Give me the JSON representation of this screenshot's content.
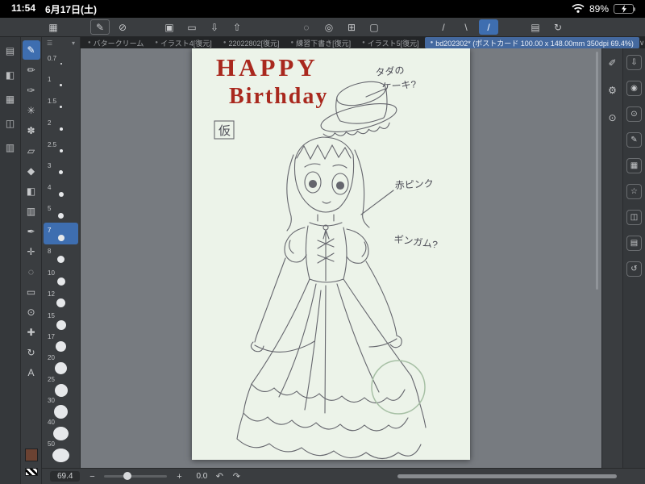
{
  "status_bar": {
    "time": "11:54",
    "date": "6月17日(土)",
    "battery": "89%"
  },
  "colors": {
    "accent_blue": "#3e6eb0",
    "canvas_bg": "#ecf3e9",
    "title_red": "#a9281e",
    "main_swatch_brown": "#6b4232",
    "battery_green": "#35c759"
  },
  "command_bar": {
    "icons": [
      {
        "name": "app-menu",
        "glyph": "▦"
      },
      {
        "name": "pen-shortcut",
        "glyph": "✎"
      },
      {
        "name": "transparent-color",
        "glyph": "⊘"
      },
      {
        "name": "new-canvas",
        "glyph": "▣"
      },
      {
        "name": "open-file",
        "glyph": "▭"
      },
      {
        "name": "save",
        "glyph": "⇩"
      },
      {
        "name": "share",
        "glyph": "⇧"
      },
      {
        "name": "select-area",
        "glyph": "◌"
      },
      {
        "name": "deselect",
        "glyph": "◎"
      },
      {
        "name": "transform",
        "glyph": "⊞"
      },
      {
        "name": "canvas-frame",
        "glyph": "▢"
      },
      {
        "name": "line-straight",
        "glyph": "/"
      },
      {
        "name": "line-curve",
        "glyph": "\\"
      },
      {
        "name": "line-rule",
        "glyph": "/"
      },
      {
        "name": "workspace",
        "glyph": "▤"
      },
      {
        "name": "reset-view",
        "glyph": "↻"
      }
    ]
  },
  "tab_bar": {
    "chevron": "∨",
    "tabs": [
      {
        "label": "バタークリーム"
      },
      {
        "label": "イラスト4[復元]"
      },
      {
        "label": "22022802[復元]"
      },
      {
        "label": "練習下書き[復元]"
      },
      {
        "label": "イラスト5[復元]"
      },
      {
        "label": "bd202302* (ポストカード 100.00 x 148.00mm 350dpi 69.4%)"
      }
    ]
  },
  "left_rail": [
    {
      "name": "layer-palette",
      "glyph": "▤"
    },
    {
      "name": "color-palette",
      "glyph": "◧"
    },
    {
      "name": "material-palette",
      "glyph": "▦"
    },
    {
      "name": "subview-palette",
      "glyph": "◫"
    },
    {
      "name": "workspace-palette",
      "glyph": "▥"
    }
  ],
  "tools": [
    {
      "name": "pen",
      "glyph": "✎"
    },
    {
      "name": "pencil",
      "glyph": "✏"
    },
    {
      "name": "brush",
      "glyph": "✑"
    },
    {
      "name": "airbrush",
      "glyph": "✳"
    },
    {
      "name": "decoration",
      "glyph": "✽"
    },
    {
      "name": "eraser",
      "glyph": "▱"
    },
    {
      "name": "blend",
      "glyph": "◆"
    },
    {
      "name": "fill",
      "glyph": "◧"
    },
    {
      "name": "gradient",
      "glyph": "▥"
    },
    {
      "name": "eyedropper",
      "glyph": "✒"
    },
    {
      "name": "move",
      "glyph": "✛"
    },
    {
      "name": "lasso",
      "glyph": "◌"
    },
    {
      "name": "selection",
      "glyph": "▭"
    },
    {
      "name": "zoom",
      "glyph": "⊙"
    },
    {
      "name": "hand",
      "glyph": "✚"
    },
    {
      "name": "rotate",
      "glyph": "↻"
    },
    {
      "name": "text",
      "glyph": "A"
    }
  ],
  "brush_sizes": {
    "header_icons": [
      {
        "name": "palette-menu",
        "glyph": "☰"
      },
      {
        "name": "collapse",
        "glyph": "▾"
      }
    ],
    "selected_label": "7",
    "items": [
      {
        "label": "0.7"
      },
      {
        "label": "1"
      },
      {
        "label": "1.5"
      },
      {
        "label": "2"
      },
      {
        "label": "2.5"
      },
      {
        "label": "3"
      },
      {
        "label": "4"
      },
      {
        "label": "5"
      },
      {
        "label": "7"
      },
      {
        "label": "8"
      },
      {
        "label": "10"
      },
      {
        "label": "12"
      },
      {
        "label": "15"
      },
      {
        "label": "17"
      },
      {
        "label": "20"
      },
      {
        "label": "25"
      },
      {
        "label": "30"
      },
      {
        "label": "40"
      },
      {
        "label": "50"
      }
    ]
  },
  "canvas": {
    "title_line1": "HAPPY",
    "title_line2": "Birthday",
    "stamp": "仮",
    "annotations": {
      "cake_line1": "タダの",
      "cake_line2": "ケーキ?",
      "pink": "赤ピンク",
      "gingham": "ギンガム?"
    }
  },
  "right_panels": {
    "inner": [
      {
        "name": "edit-pen",
        "glyph": "✐"
      },
      {
        "name": "settings-gear",
        "glyph": "⚙"
      },
      {
        "name": "search",
        "glyph": "⊙"
      }
    ],
    "outer": [
      {
        "name": "import",
        "glyph": "⇩"
      },
      {
        "name": "camera",
        "glyph": "◉"
      },
      {
        "name": "search-panel",
        "glyph": "⊙"
      },
      {
        "name": "brush-panel",
        "glyph": "✎"
      },
      {
        "name": "material-panel",
        "glyph": "▦"
      },
      {
        "name": "favorites",
        "glyph": "☆"
      },
      {
        "name": "navigator",
        "glyph": "◫"
      },
      {
        "name": "layers-panel",
        "glyph": "▤"
      },
      {
        "name": "history",
        "glyph": "↺"
      }
    ]
  },
  "bottom_bar": {
    "zoom": "69.4",
    "minus": "−",
    "plus": "+",
    "rotation": "0.0",
    "undo": "↶",
    "redo": "↷"
  }
}
